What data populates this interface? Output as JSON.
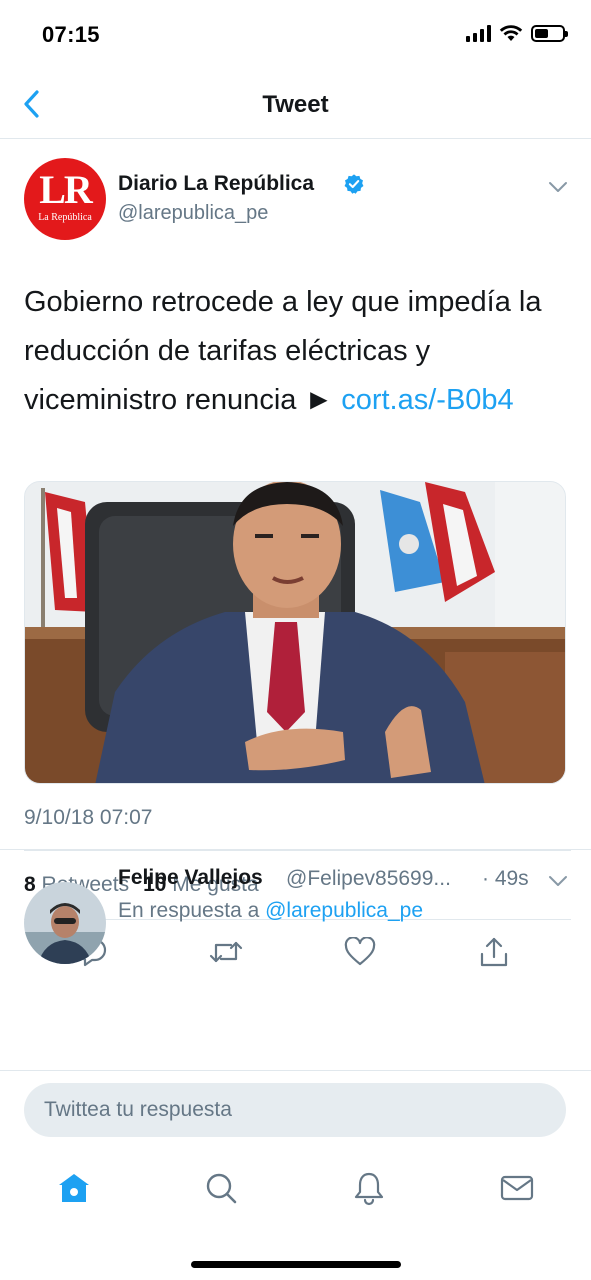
{
  "status_bar": {
    "time": "07:15"
  },
  "nav": {
    "title": "Tweet"
  },
  "tweet": {
    "avatar_text": "LR",
    "avatar_subtext": "La República",
    "author_name": "Diario La República",
    "author_handle": "@larepublica_pe",
    "text": "Gobierno retrocede a ley que impedía la reducción de tarifas eléctricas y viceministro renuncia ► ",
    "link": "cort.as/-B0b4",
    "timestamp": "9/10/18 07:07",
    "stats": {
      "retweets_count": "8",
      "retweets_label": "Retweets",
      "likes_count": "10",
      "likes_label": "Me gusta"
    }
  },
  "reply": {
    "name": "Felipe Vallejos",
    "handle": "@Felipev85699...",
    "time": "· 49s",
    "reply_to_prefix": "En respuesta a ",
    "reply_to_handle": "@larepublica_pe"
  },
  "composer": {
    "placeholder": "Twittea tu respuesta"
  },
  "colors": {
    "accent": "#1da1f2",
    "text": "#14171a",
    "secondary": "#657786",
    "divider": "#e1e8ed",
    "brand_red": "#e3191b"
  },
  "icons": {
    "back": "chevron-left-icon",
    "verified": "verified-badge-icon",
    "caret": "chevron-down-icon",
    "reply": "reply-icon",
    "retweet": "retweet-icon",
    "like": "heart-icon",
    "share": "share-icon",
    "home": "home-icon",
    "search": "search-icon",
    "notifications": "bell-icon",
    "messages": "mail-icon"
  }
}
